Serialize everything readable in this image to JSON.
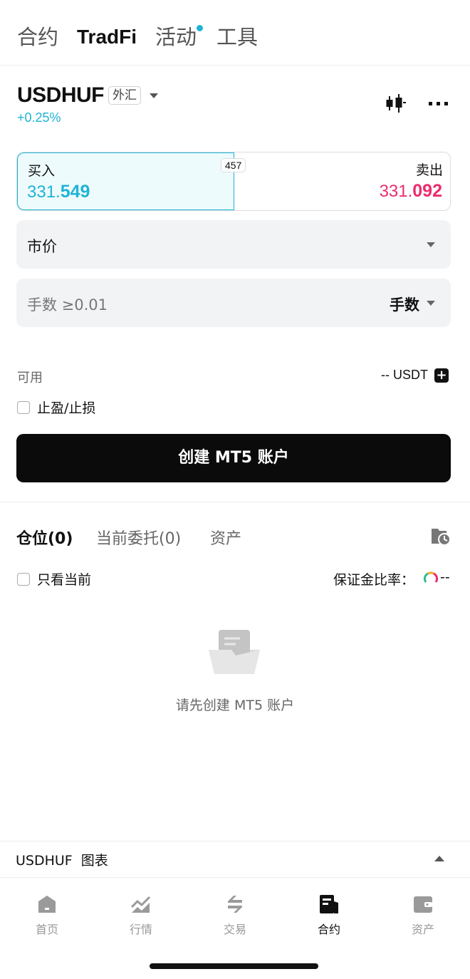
{
  "top_tabs": [
    "合约",
    "TradFi",
    "活动",
    "工具"
  ],
  "pair": {
    "name": "USDHUF",
    "tag": "外汇",
    "change": "+0.25%"
  },
  "prices": {
    "buy_label": "买入",
    "buy_price_prefix": "331.",
    "buy_price_emph": "549",
    "sell_label": "卖出",
    "sell_price_prefix": "331.",
    "sell_price_emph": "092",
    "spread": "457"
  },
  "order": {
    "type": "市价",
    "qty_placeholder": "手数 ≥0.01",
    "qty_unit": "手数"
  },
  "available": {
    "label": "可用",
    "value": "-- USDT"
  },
  "tpsl_label": "止盈/止损",
  "cta_label": "创建 MT5 账户",
  "position_tabs": [
    "仓位(0)",
    "当前委托(0)",
    "资产"
  ],
  "only_current_label": "只看当前",
  "margin": {
    "label": "保证金比率：",
    "value": "--"
  },
  "empty_text": "请先创建 MT5 账户",
  "chart_bar_label": "USDHUF  图表",
  "bottom_nav": [
    "首页",
    "行情",
    "交易",
    "合约",
    "资产"
  ],
  "colors": {
    "accent": "#1fb4d6",
    "sell": "#ec2c6c"
  }
}
